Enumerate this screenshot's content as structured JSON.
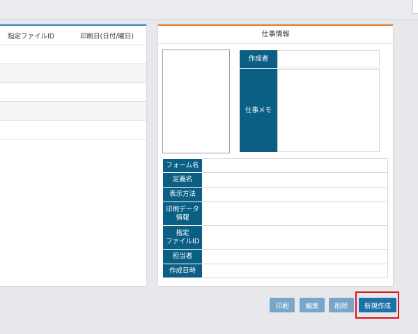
{
  "list": {
    "columns": [
      "指定ファイルID",
      "印刷日(日付/曜日)"
    ]
  },
  "detail": {
    "title": "仕事情報",
    "creator_label": "作成者",
    "memo_label": "仕事メモ",
    "fields": [
      {
        "label": "フォーム名"
      },
      {
        "label": "定義名"
      },
      {
        "label": "表示方法"
      },
      {
        "label": "印刷データ\n情報"
      },
      {
        "label": "指定\nファイルID"
      },
      {
        "label": "担当者"
      },
      {
        "label": "作成日時"
      }
    ]
  },
  "buttons": {
    "print": "印刷",
    "edit": "編集",
    "delete": "削除",
    "new": "新規作成"
  }
}
